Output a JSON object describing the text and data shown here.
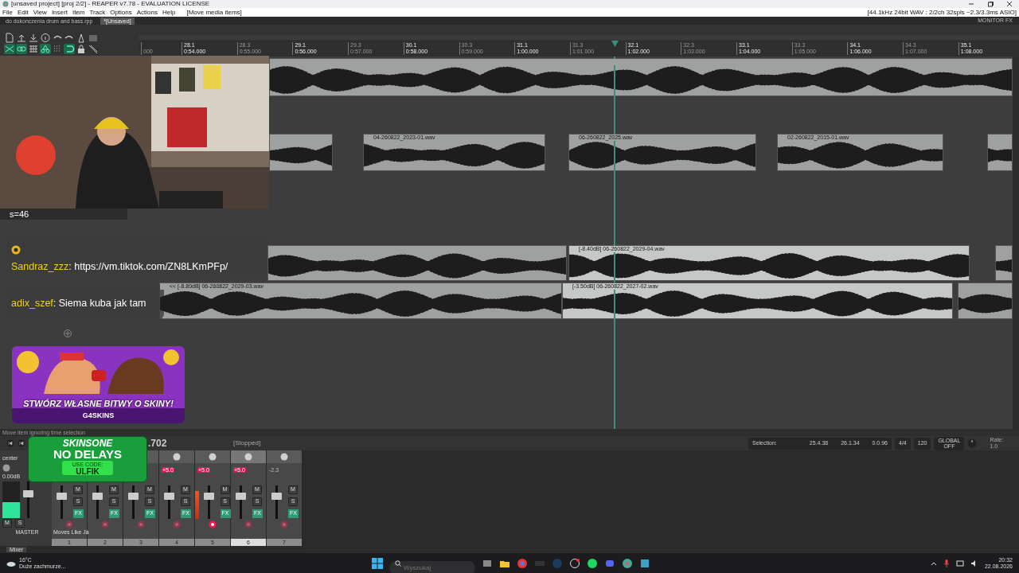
{
  "window": {
    "title": "[unsaved project] [proj 2/2] - REAPER v7.78 - EVALUATION LICENSE"
  },
  "menu": [
    "File",
    "Edit",
    "View",
    "Insert",
    "Item",
    "Track",
    "Options",
    "Actions",
    "Help"
  ],
  "menu_status": "[Move media items]",
  "audio_status": "[44.1kHz 24bit WAV : 2/2ch 32spls ~2.3/3.3ms ASIO]",
  "project_tabs": [
    {
      "label": "do dokonczenia drum and bass.rpp",
      "selected": false
    },
    {
      "label": "*[Unsaved]",
      "selected": true
    }
  ],
  "monitor_fx": "MONITOR FX",
  "toolbar": [
    {
      "kind": "new",
      "on": false
    },
    {
      "kind": "open",
      "on": false
    },
    {
      "kind": "save",
      "on": false
    },
    {
      "kind": "info",
      "on": false
    },
    {
      "kind": "undo",
      "on": false
    },
    {
      "kind": "redo",
      "on": false
    },
    {
      "kind": "metronome",
      "on": false
    },
    {
      "kind": "square",
      "on": false
    },
    {
      "kind": "ripple",
      "on": true
    },
    {
      "kind": "link",
      "on": true
    },
    {
      "kind": "grid",
      "on": false
    },
    {
      "kind": "snap",
      "on": true
    },
    {
      "kind": "dots",
      "on": false
    },
    {
      "kind": "loop",
      "on": true
    },
    {
      "kind": "lock",
      "on": false
    },
    {
      "kind": "envelope",
      "on": false
    }
  ],
  "ruler": [
    {
      "time": "000",
      "major": false
    },
    {
      "bar": "28.1",
      "time": "0:54.000",
      "major": true
    },
    {
      "bar": "28.3",
      "time": "0:55.000",
      "major": false
    },
    {
      "bar": "29.1",
      "time": "0:56.000",
      "major": true
    },
    {
      "bar": "29.3",
      "time": "0:57.000",
      "major": false
    },
    {
      "bar": "30.1",
      "time": "0:58.000",
      "major": true
    },
    {
      "bar": "30.3",
      "time": "0:59.000",
      "major": false
    },
    {
      "bar": "31.1",
      "time": "1:00.000",
      "major": true
    },
    {
      "bar": "31.3",
      "time": "1:01.000",
      "major": false
    },
    {
      "bar": "32.1",
      "time": "1:02.000",
      "major": true
    },
    {
      "bar": "32.3",
      "time": "1:03.000",
      "major": false
    },
    {
      "bar": "33.1",
      "time": "1:04.000",
      "major": true
    },
    {
      "bar": "33.3",
      "time": "1:05.000",
      "major": false
    },
    {
      "bar": "34.1",
      "time": "1:06.000",
      "major": true
    },
    {
      "bar": "34.3",
      "time": "1:07.000",
      "major": false
    },
    {
      "bar": "35.1",
      "time": "1:08.000",
      "major": true
    }
  ],
  "tracks": [
    {
      "items": [
        {
          "selected": false
        }
      ]
    },
    {
      "items": [
        {
          "selected": false
        },
        {
          "label": "04-260822_2023-01.wav",
          "selected": false
        },
        {
          "label": "06-260822_2025.wav",
          "selected": false
        },
        {
          "label": "02-260822_2015-01.wav",
          "selected": false
        },
        {
          "selected": false
        }
      ]
    },
    {
      "items": [
        {
          "selected": false
        },
        {
          "label": "[-8.40dB] 06-260822_2029-04.wav",
          "selected": true
        },
        {
          "selected": false
        }
      ]
    },
    {
      "items": [
        {
          "label": "<< [-8.80dB] 06-260822_2029-03.wav",
          "selected": false
        },
        {
          "label": "[-3.50dB] 06-260822_2027-02.wav",
          "selected": true
        },
        {
          "selected": false
        }
      ]
    }
  ],
  "overlay": {
    "counter": "s=46",
    "chat": [
      {
        "user": "Sandraz_zzz",
        "text": ": https://vm.tiktok.com/ZN8LKmPFp/"
      },
      {
        "user": "adix_szef",
        "text": ": Siema kuba jak tam"
      }
    ],
    "promo": {
      "headline": "STWÓRZ WŁASNE BITWY O SKINY!",
      "brand": "G4SKINS"
    },
    "sponsor": {
      "brand": "SKINSONE",
      "slogan": "NO DELAYS",
      "code_label": "USE CODE:",
      "code": "ULFIK"
    }
  },
  "status": "Move item ignoring time selection",
  "transport": {
    "time": ".702",
    "state": "[Stopped]"
  },
  "selection": {
    "label": "Selection:",
    "start": "25.4.38",
    "end": "26.1.34",
    "length": "0.0.96",
    "signature": "4/4",
    "tempo": "120",
    "global_label": "GLOBAL",
    "global_state": "OFF",
    "rate_label": "Rate:",
    "rate": "1.0"
  },
  "mixer": {
    "tab": "Mixer",
    "master": {
      "label": "MASTER",
      "header": "center",
      "volume": "0.00dB",
      "meter": {
        "level": 0.45
      },
      "fader": {
        "level": 0.7
      },
      "buttons": [
        "M",
        "S"
      ]
    },
    "channels": [
      {
        "number": "1",
        "name": "Moves Like Ja",
        "selected": false,
        "armed": false,
        "fader": {
          "level": 0.72
        },
        "buttons": [
          "M",
          "S",
          "FX"
        ]
      },
      {
        "number": "2",
        "selected": false,
        "armed": false,
        "fader": {
          "level": 0.72
        },
        "buttons": [
          "M",
          "S",
          "FX"
        ]
      },
      {
        "number": "3",
        "selected": false,
        "armed": false,
        "fader": {
          "level": 0.72
        },
        "buttons": [
          "M",
          "S",
          "FX"
        ]
      },
      {
        "number": "4",
        "peak": "+5.0",
        "clipped": true,
        "selected": false,
        "armed": false,
        "fader": {
          "level": 0.72
        },
        "buttons": [
          "M",
          "S",
          "FX"
        ]
      },
      {
        "number": "5",
        "peak": "+5.0",
        "clipped": true,
        "selected": false,
        "armed": true,
        "fader": {
          "level": 0.72
        },
        "meter": {
          "level": 0.85
        },
        "buttons": [
          "M",
          "S",
          "FX"
        ]
      },
      {
        "number": "6",
        "peak": "+5.0",
        "clipped": true,
        "selected": true,
        "armed": false,
        "fader": {
          "level": 0.72
        },
        "buttons": [
          "M",
          "S",
          "FX"
        ]
      },
      {
        "number": "7",
        "peak": "-2.3",
        "clipped": false,
        "selected": false,
        "armed": false,
        "fader": {
          "level": 0.72
        },
        "buttons": [
          "M",
          "S",
          "FX"
        ]
      }
    ]
  },
  "taskbar": {
    "weather_temp": "16°C",
    "weather_text": "Duże zachmurze...",
    "search_placeholder": "Wyszukaj",
    "time": "20:32",
    "date": "22.08.2026"
  }
}
